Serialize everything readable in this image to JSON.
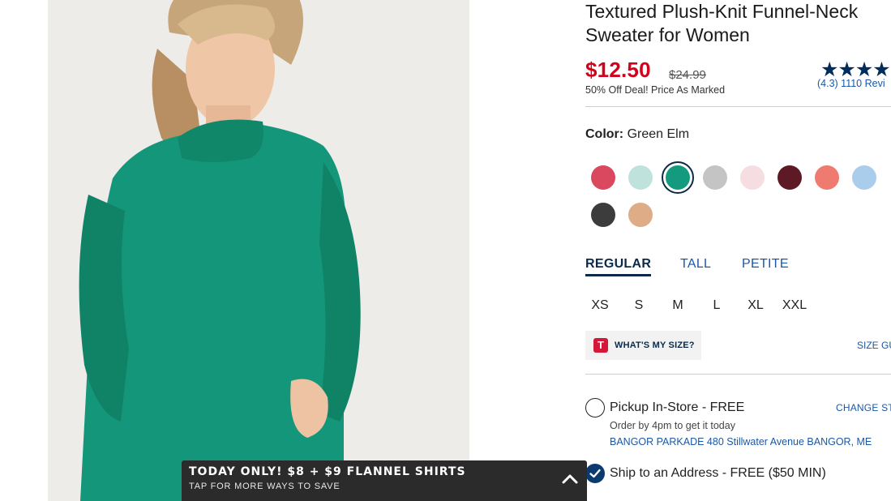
{
  "product": {
    "title": "Textured Plush-Knit Funnel-Neck Sweater for Women",
    "sale_price": "$12.50",
    "original_price": "$24.99",
    "deal_text": "50% Off Deal! Price As Marked",
    "stars": "★★★★",
    "reviews_text": "(4.3) 1110 Revi"
  },
  "color": {
    "label": "Color:",
    "value": "Green Elm",
    "swatches": [
      "#d9485e",
      "#bfe3dc",
      "#149a7f",
      "#c4c4c4",
      "#f6dde1",
      "#5e1a24",
      "#ef7a6f",
      "#a9cdeb",
      "#3c3c3c",
      "#deac86"
    ]
  },
  "fit_tabs": [
    "REGULAR",
    "TALL",
    "PETITE"
  ],
  "sizes": [
    "XS",
    "S",
    "M",
    "L",
    "XL",
    "XXL"
  ],
  "whats_my_size": {
    "icon_letter": "T",
    "label": "WHAT'S MY SIZE?"
  },
  "size_guide": "SIZE GU",
  "fulfillment": {
    "pickup_label": "Pickup In-Store - FREE",
    "change_store": "CHANGE ST",
    "order_by": "Order by 4pm to get it today",
    "store_text": "BANGOR PARKADE 480 Stillwater Avenue  BANGOR, ME",
    "ship_label": "Ship to an Address - FREE ($50 MIN)"
  },
  "promo_banner": {
    "headline": "TODAY ONLY! $8 + $9 FLANNEL SHIRTS",
    "subtext": "TAP FOR MORE WAYS TO SAVE"
  },
  "colors": {
    "sale_red": "#d1021b",
    "navy": "#0b2a4a",
    "link_blue": "#1a58a6",
    "sweater_green": "#14967a"
  }
}
